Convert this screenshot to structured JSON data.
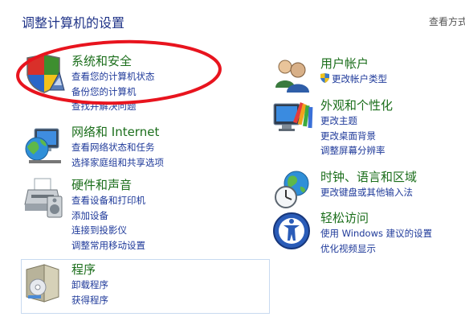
{
  "header": {
    "title": "调整计算机的设置",
    "view_by": "查看方式"
  },
  "categories": [
    {
      "title": "系统和安全",
      "links": [
        "查看您的计算机状态",
        "备份您的计算机",
        "查找并解决问题"
      ]
    },
    {
      "title": "网络和 Internet",
      "links": [
        "查看网络状态和任务",
        "选择家庭组和共享选项"
      ]
    },
    {
      "title": "硬件和声音",
      "links": [
        "查看设备和打印机",
        "添加设备",
        "连接到投影仪",
        "调整常用移动设置"
      ]
    },
    {
      "title": "程序",
      "links": [
        "卸载程序",
        "获得程序"
      ]
    },
    {
      "title": "用户帐户",
      "links": [
        "更改帐户类型"
      ]
    },
    {
      "title": "外观和个性化",
      "links": [
        "更改主题",
        "更改桌面背景",
        "调整屏幕分辨率"
      ]
    },
    {
      "title": "时钟、语言和区域",
      "links": [
        "更改键盘或其他输入法"
      ]
    },
    {
      "title": "轻松访问",
      "links": [
        "使用 Windows 建议的设置",
        "优化视频显示"
      ]
    }
  ],
  "colors": {
    "title": "#1e3287",
    "category_title": "#1b6e1b",
    "link": "#1f3a9a",
    "annotation": "#e8141e"
  }
}
